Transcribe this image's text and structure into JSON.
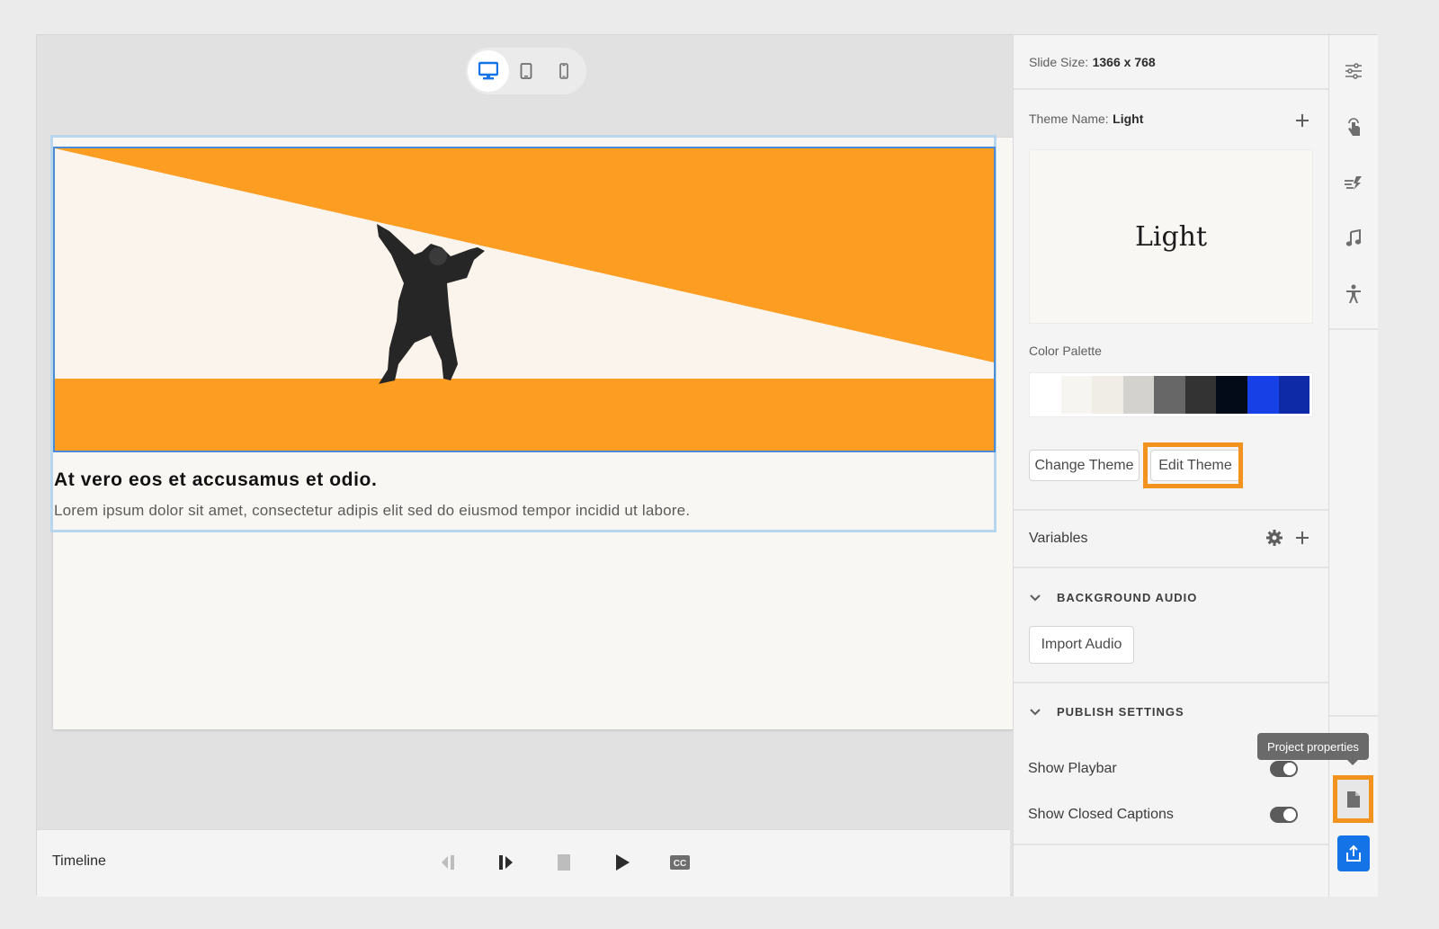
{
  "stage": {
    "device_modes": [
      {
        "name": "desktop",
        "icon": "desktop-icon",
        "active": true
      },
      {
        "name": "tablet",
        "icon": "tablet-icon",
        "active": false
      },
      {
        "name": "mobile",
        "icon": "mobile-icon",
        "active": false
      }
    ],
    "slide": {
      "headline": "At vero eos et accusamus et odio.",
      "body": "Lorem ipsum dolor sit amet, consectetur adipis elit sed do eiusmod tempor incidid ut labore.",
      "image_description": "Man in suit holding up orange diagonal band",
      "accent_color": "#fd9d21"
    }
  },
  "timeline": {
    "label": "Timeline",
    "controls": [
      "previous",
      "next",
      "stop",
      "play",
      "closed-captions"
    ],
    "cc_label": "CC"
  },
  "properties": {
    "slide_size_label": "Slide Size:",
    "slide_size_value": "1366 x 768",
    "theme_name_label": "Theme Name:",
    "theme_name_value": "Light",
    "theme_preview_text": "Light",
    "color_palette_label": "Color Palette",
    "palette": [
      "#ffffff",
      "#f7f5f1",
      "#efede6",
      "#d3d2cf",
      "#676767",
      "#333333",
      "#020b17",
      "#1740e6",
      "#0e2aa6"
    ],
    "change_theme_label": "Change Theme",
    "edit_theme_label": "Edit Theme",
    "variables_label": "Variables",
    "background_audio_label": "BACKGROUND AUDIO",
    "import_audio_label": "Import Audio",
    "publish_settings_label": "PUBLISH SETTINGS",
    "show_playbar_label": "Show Playbar",
    "show_playbar_on": true,
    "show_cc_label": "Show Closed Captions",
    "show_cc_on": true
  },
  "rail": {
    "icons": [
      "properties-sliders-icon",
      "interaction-hand-icon",
      "animation-icon",
      "audio-note-icon",
      "accessibility-icon"
    ],
    "tooltip": "Project properties",
    "highlight_color": "#f2921f",
    "publish_color": "#1473e6"
  }
}
